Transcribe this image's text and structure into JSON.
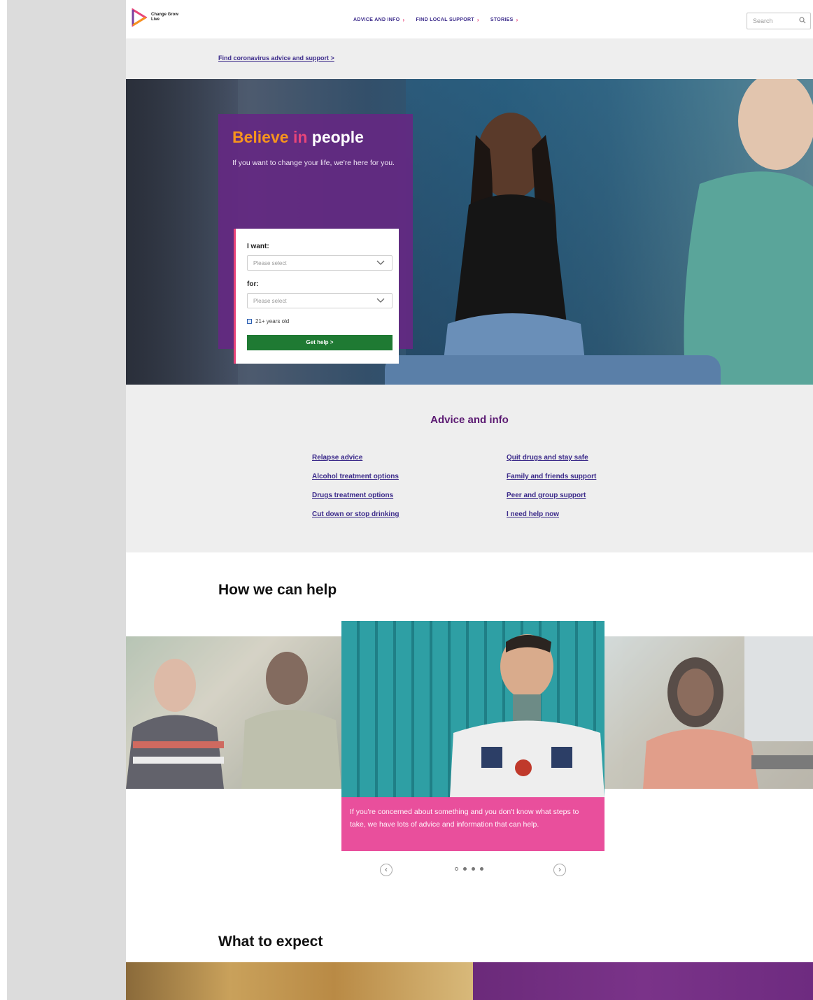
{
  "header": {
    "logo_text": "Change Grow Live",
    "nav": [
      "ADVICE AND INFO",
      "FIND LOCAL SUPPORT",
      "STORIES"
    ],
    "search_placeholder": "Search"
  },
  "covid_banner": {
    "link": "Find coronavirus advice and support >"
  },
  "hero": {
    "title_part1": "Believe",
    "title_part2": "in",
    "title_part3": "people",
    "subtitle": "If you want to change your life, we're here for you.",
    "form": {
      "want_label": "I want:",
      "want_placeholder": "Please select",
      "for_label": "for:",
      "for_placeholder": "Please select",
      "age_checkbox": "21+ years old",
      "submit": "Get help >"
    }
  },
  "advice": {
    "title": "Advice and info",
    "left_links": [
      "Relapse advice",
      "Alcohol treatment options",
      "Drugs treatment options",
      "Cut down or stop drinking"
    ],
    "right_links": [
      "Quit drugs and stay safe",
      "Family and friends support",
      "Peer and group support",
      "I need help now"
    ]
  },
  "how_we_can_help": {
    "title": "How we can help",
    "caption": "If you're concerned about something and you don't know what steps to take, we have lots of advice and information that can help.",
    "prev": "‹",
    "next": "›",
    "dot_count": 4,
    "active_dot": 0
  },
  "what_to_expect": {
    "title": "What to expect"
  },
  "colors": {
    "purple": "#5b1a72",
    "pink": "#e94f9c",
    "orange": "#f7941d",
    "green": "#1f7a33",
    "link": "#3b2a8a"
  }
}
